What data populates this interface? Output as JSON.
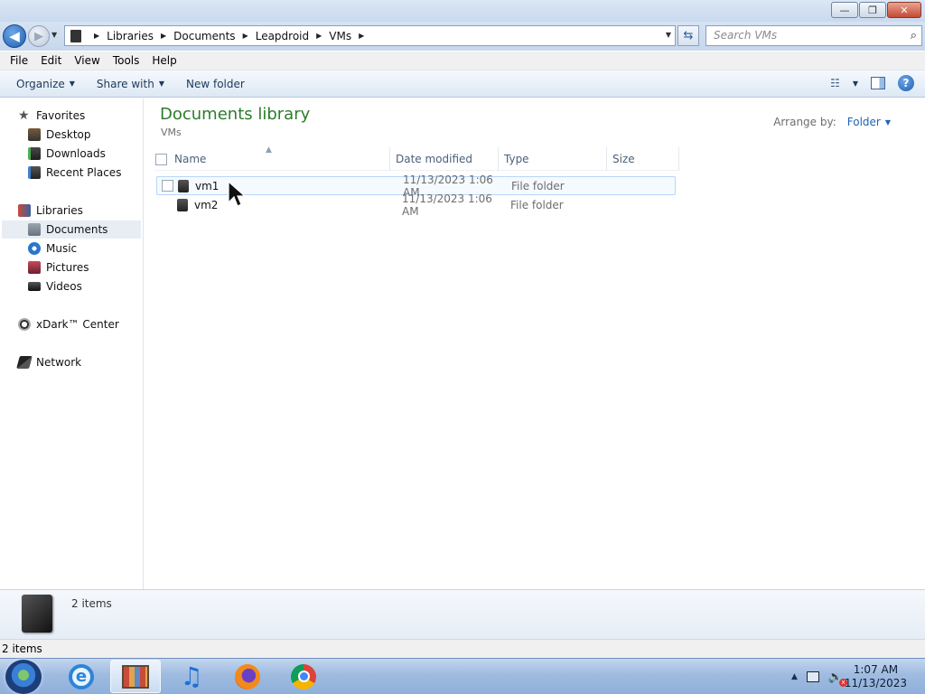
{
  "window": {
    "controls": {
      "minimize": "—",
      "maximize": "❐",
      "close": "✕"
    }
  },
  "address": {
    "crumbs": [
      "Libraries",
      "Documents",
      "Leapdroid",
      "VMs"
    ],
    "search_placeholder": "Search VMs"
  },
  "menu": [
    "File",
    "Edit",
    "View",
    "Tools",
    "Help"
  ],
  "toolbar": {
    "organize": "Organize",
    "share_with": "Share with",
    "new_folder": "New folder"
  },
  "nav": {
    "favorites": "Favorites",
    "desktop": "Desktop",
    "downloads": "Downloads",
    "recent_places": "Recent Places",
    "libraries": "Libraries",
    "documents": "Documents",
    "music": "Music",
    "pictures": "Pictures",
    "videos": "Videos",
    "xdark": "xDark™ Center",
    "network": "Network"
  },
  "library": {
    "title": "Documents library",
    "subtitle": "VMs",
    "arrange_label": "Arrange by:",
    "arrange_value": "Folder"
  },
  "columns": {
    "name": "Name",
    "date": "Date modified",
    "type": "Type",
    "size": "Size"
  },
  "files": [
    {
      "name": "vm1",
      "date": "11/13/2023 1:06 AM",
      "type": "File folder"
    },
    {
      "name": "vm2",
      "date": "11/13/2023 1:06 AM",
      "type": "File folder"
    }
  ],
  "details": {
    "count": "2 items"
  },
  "status": {
    "count": "2 items"
  },
  "clock": {
    "time": "1:07 AM",
    "date": "11/13/2023"
  },
  "colors": {
    "library_title": "#2a7d2a",
    "link": "#1e63b6"
  }
}
